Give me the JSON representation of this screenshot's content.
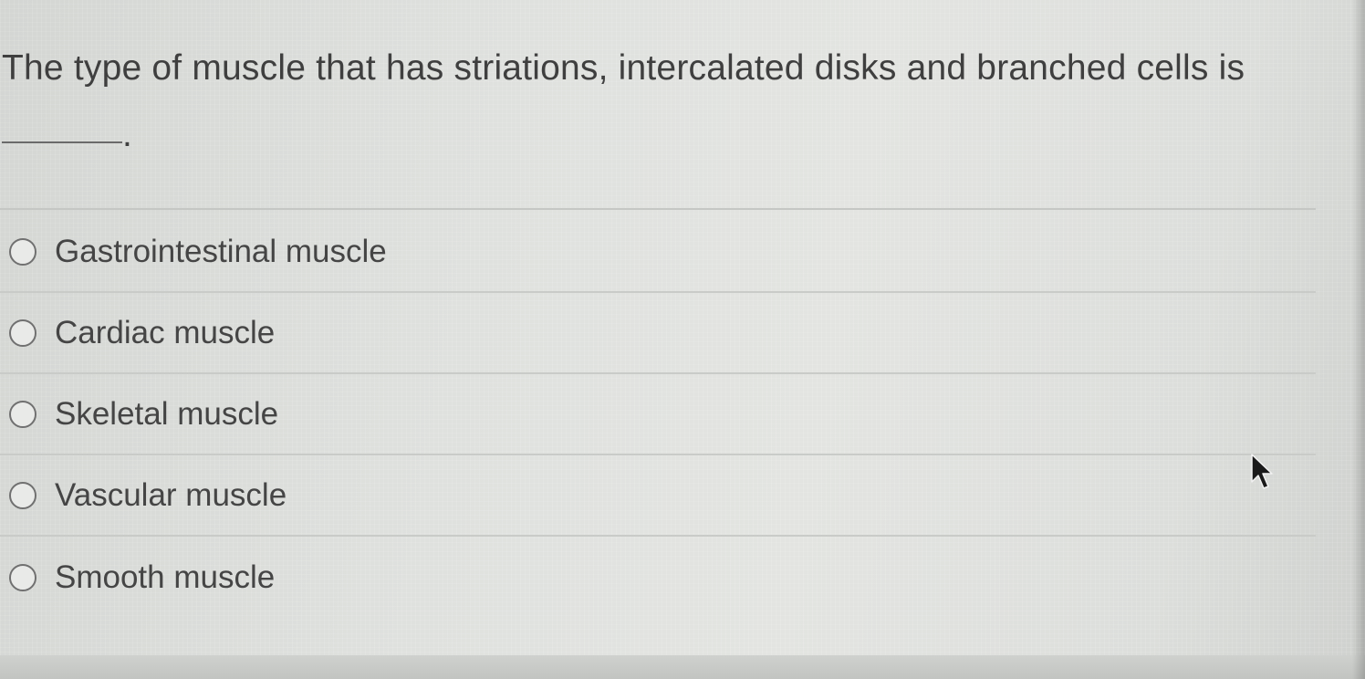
{
  "question": {
    "text": "The type of muscle that has striations, intercalated disks and branched cells is",
    "blank_suffix": "."
  },
  "options": [
    {
      "label": "Gastrointestinal muscle",
      "selected": false
    },
    {
      "label": "Cardiac muscle",
      "selected": false
    },
    {
      "label": "Skeletal muscle",
      "selected": false
    },
    {
      "label": "Vascular muscle",
      "selected": false
    },
    {
      "label": "Smooth muscle",
      "selected": false
    }
  ],
  "colors": {
    "text": "#3f3f3f",
    "radio_border": "#707070",
    "separator": "#c9cbc8",
    "background": "#dadcd9"
  },
  "icons": {
    "cursor": "mouse-pointer-arrow-icon"
  }
}
